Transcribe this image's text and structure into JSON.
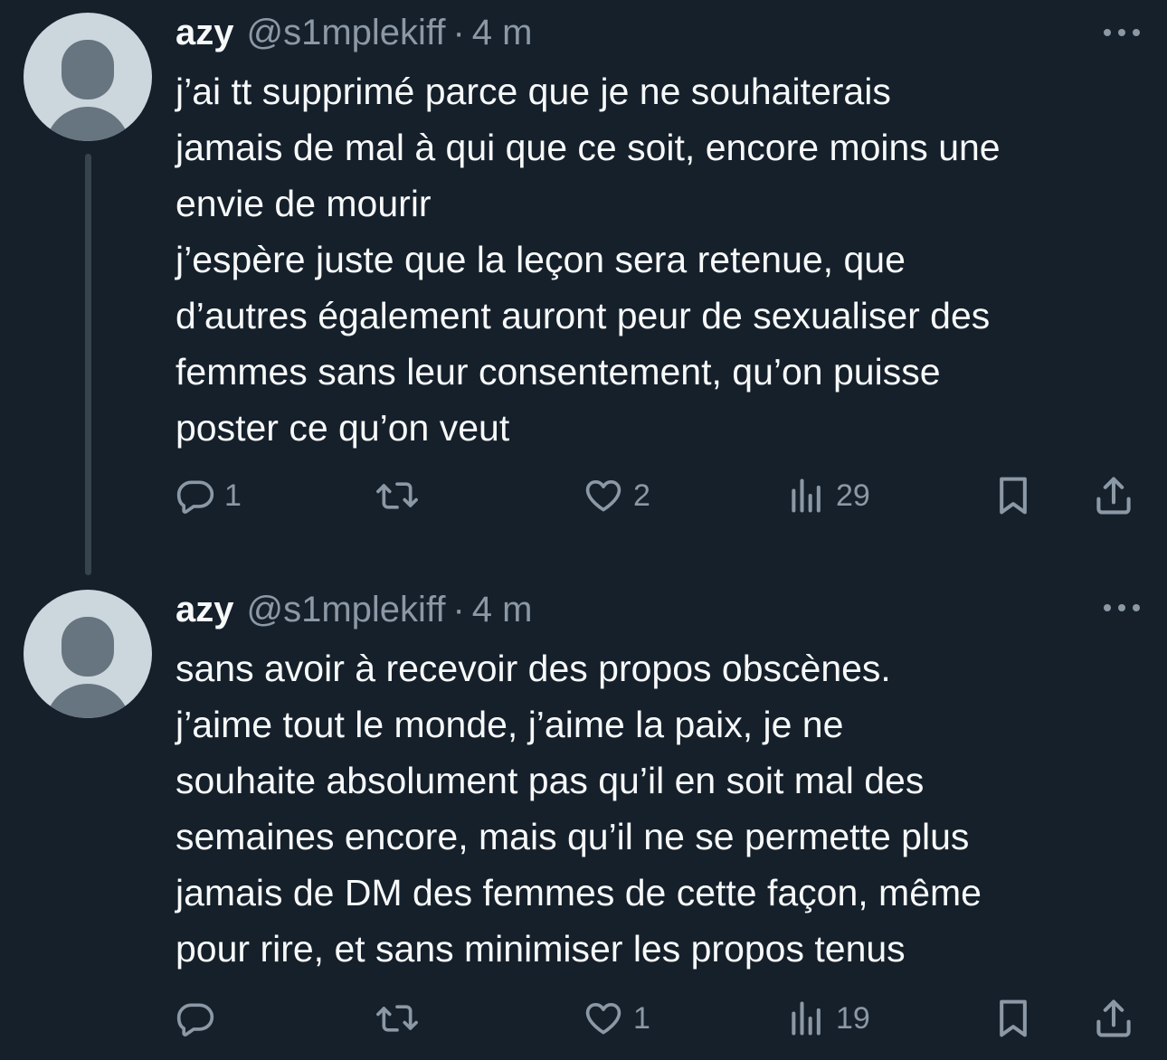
{
  "tweets": [
    {
      "display_name": "azy",
      "handle": "@s1mplekiff",
      "separator": "·",
      "time": "4 m",
      "lines": [
        "j’ai tt supprimé parce que je ne souhaiterais",
        "jamais de mal à qui que ce soit, encore moins une",
        "envie de mourir",
        "j’espère juste que la leçon sera retenue, que",
        "d’autres également auront peur de sexualiser des",
        "femmes sans leur consentement, qu’on puisse",
        "poster ce qu’on veut"
      ],
      "stats": {
        "replies": "1",
        "retweets": "",
        "likes": "2",
        "views": "29"
      }
    },
    {
      "display_name": "azy",
      "handle": "@s1mplekiff",
      "separator": "·",
      "time": "4 m",
      "lines": [
        "sans avoir à recevoir des propos obscènes.",
        "j’aime tout le monde, j’aime la paix, je ne",
        "souhaite absolument pas qu’il en soit mal des",
        "semaines encore, mais qu’il ne se permette plus",
        "jamais de DM des femmes de cette façon, même",
        "pour rire, et sans minimiser les propos tenus"
      ],
      "stats": {
        "replies": "",
        "retweets": "",
        "likes": "1",
        "views": "19"
      }
    }
  ],
  "icons": {
    "reply": "reply-icon",
    "retweet": "retweet-icon",
    "like": "heart-icon",
    "views": "views-icon",
    "bookmark": "bookmark-icon",
    "share": "share-icon",
    "more": "more-icon"
  },
  "colors": {
    "background": "#15202b",
    "text": "#f7f9f9",
    "muted": "#8b98a5",
    "thread_line": "#38444d",
    "avatar_bg": "#ccd6dd",
    "avatar_fg": "#66757f"
  }
}
